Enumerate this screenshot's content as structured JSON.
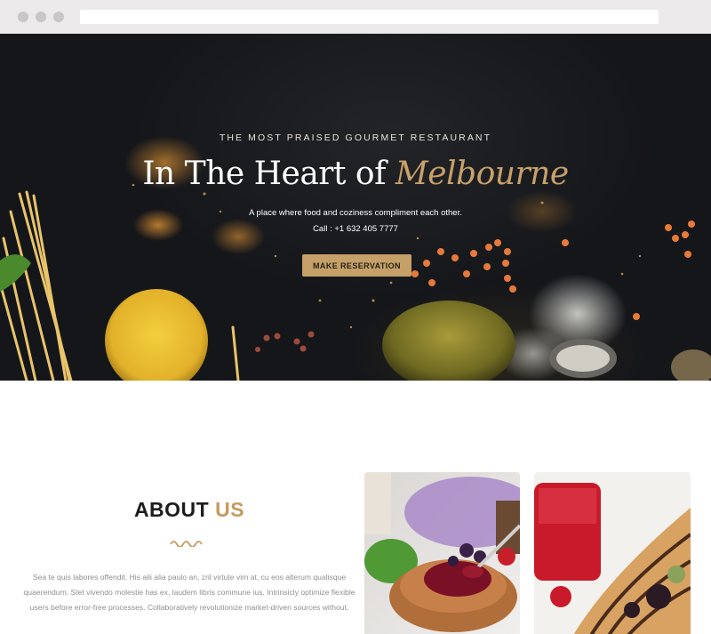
{
  "hero": {
    "kicker": "THE MOST PRAISED GOURMET RESTAURANT",
    "title_main": "In The Heart of ",
    "title_accent": "Melbourne",
    "subtitle": "A place where food and coziness compliment each other.",
    "call": "Call : +1 632 405 7777",
    "cta_label": "MAKE RESERVATION"
  },
  "about": {
    "title_main": "ABOUT ",
    "title_accent": "US",
    "text": "Sea te quis labores offendit. His alii alia paulo an, zril virtute vim at, cu eos alterum qualisque quaerendum. Stet vivendo molestie has ex, laudem libris commune ius. Intrinsicly optimize flexible users before error-free processes. Collaboratively revolutionize market-driven sources without."
  },
  "colors": {
    "accent": "#c8a06a",
    "button": "#c5a068",
    "hero_bg": "#17181c"
  }
}
